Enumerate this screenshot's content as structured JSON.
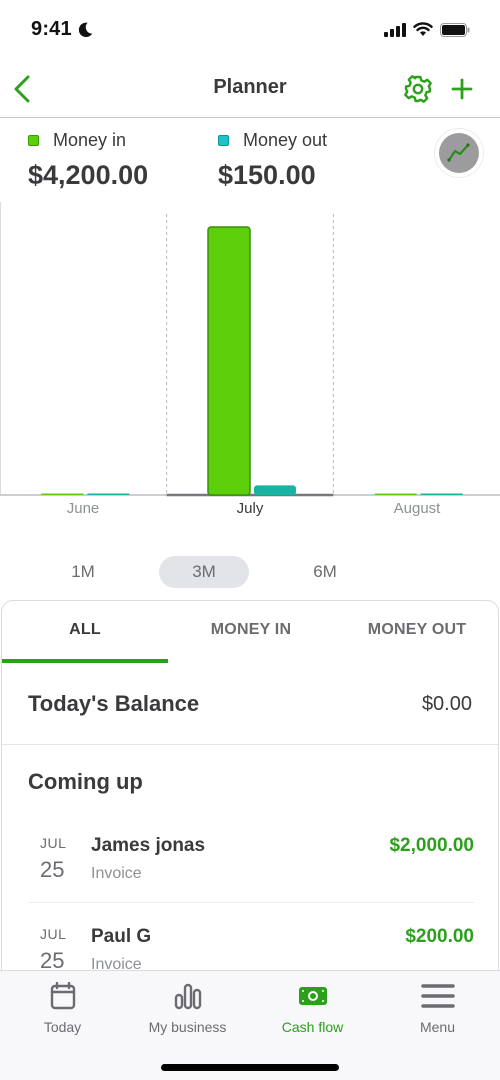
{
  "status_bar": {
    "time": "9:41",
    "icons": [
      "moon-icon",
      "signal-icon",
      "wifi-icon",
      "battery-icon"
    ]
  },
  "nav": {
    "title": "Planner",
    "back_icon": "chevron-left-icon",
    "settings_icon": "gear-icon",
    "add_icon": "plus-icon"
  },
  "summary": {
    "money_in_label": "Money in",
    "money_in_value": "$4,200.00",
    "money_out_label": "Money out",
    "money_out_value": "$150.00",
    "trend_icon": "trend-line-icon"
  },
  "colors": {
    "brand_green": "#2ca01c",
    "money_in": "#5ccf0a",
    "money_out": "#17b3a3",
    "text_dark": "#393a3d",
    "text_muted": "#6b6c72"
  },
  "chart_data": {
    "type": "bar",
    "categories": [
      "June",
      "July",
      "August"
    ],
    "selected_category": "July",
    "series": [
      {
        "name": "Money in",
        "values": [
          0,
          4200,
          0
        ],
        "color": "#5ccf0a"
      },
      {
        "name": "Money out",
        "values": [
          0,
          150,
          0
        ],
        "color": "#17b3a3"
      }
    ],
    "ylim": [
      0,
      4200
    ],
    "grid": false,
    "legend": "top-left"
  },
  "range": {
    "options": [
      "1M",
      "3M",
      "6M"
    ],
    "selected": "3M"
  },
  "tabs": {
    "items": [
      "ALL",
      "MONEY IN",
      "MONEY OUT"
    ],
    "selected": "ALL"
  },
  "balance": {
    "label": "Today's Balance",
    "value": "$0.00"
  },
  "coming_up": {
    "title": "Coming up",
    "items": [
      {
        "month": "JUL",
        "day": "25",
        "name": "James jonas",
        "type": "Invoice",
        "amount": "$2,000.00"
      },
      {
        "month": "JUL",
        "day": "25",
        "name": "Paul G",
        "type": "Invoice",
        "amount": "$200.00"
      }
    ]
  },
  "tabbar": {
    "items": [
      {
        "label": "Today",
        "icon": "calendar-icon"
      },
      {
        "label": "My business",
        "icon": "bar-chart-icon"
      },
      {
        "label": "Cash flow",
        "icon": "cash-icon"
      },
      {
        "label": "Menu",
        "icon": "hamburger-menu-icon"
      }
    ],
    "selected": "Cash flow"
  }
}
